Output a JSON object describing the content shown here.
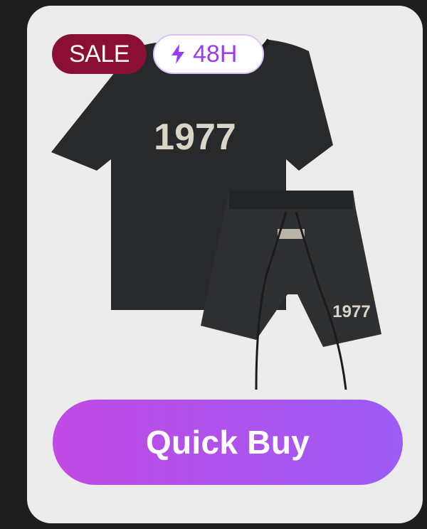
{
  "badges": {
    "sale_label": "SALE",
    "timer_label": "48H",
    "timer_icon": "lightning-bolt-icon"
  },
  "product": {
    "tee_print": "1977",
    "shorts_print": "1977",
    "colors": {
      "garment": "#28292b",
      "print": "#d9d6c8"
    }
  },
  "cta": {
    "quick_buy_label": "Quick Buy"
  },
  "colors": {
    "background": "#1e1e1e",
    "card": "#ececec",
    "sale": "#8b0f35",
    "timer_text": "#9a3df0",
    "button_gradient_start": "#c04ae3",
    "button_gradient_end": "#9c5cf5"
  }
}
